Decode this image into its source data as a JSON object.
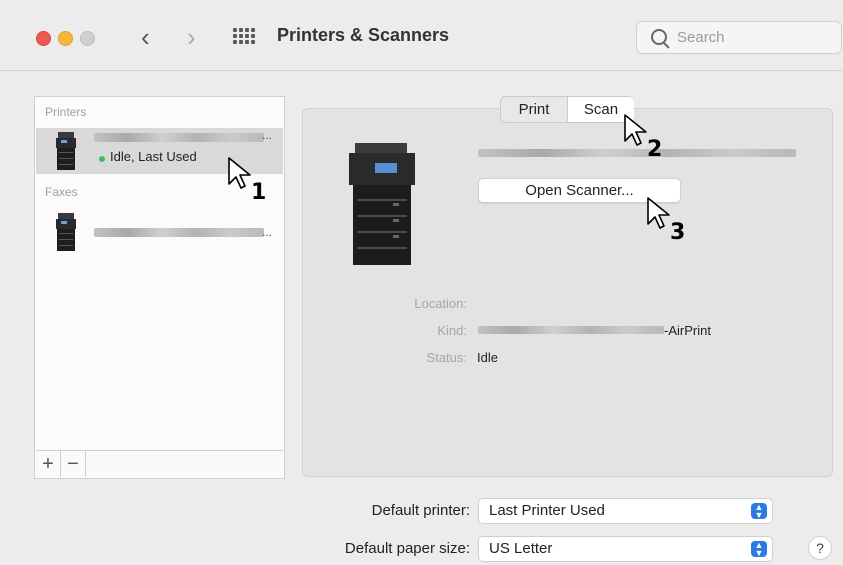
{
  "window": {
    "title": "Printers & Scanners",
    "search_placeholder": "Search"
  },
  "sidebar": {
    "printers_label": "Printers",
    "faxes_label": "Faxes",
    "printer_status": "Idle, Last Used",
    "ellipsis": "...",
    "add_label": "+",
    "remove_label": "−"
  },
  "tabs": {
    "print": "Print",
    "scan": "Scan",
    "selected": "Scan"
  },
  "detail": {
    "open_scanner_label": "Open Scanner...",
    "location_label": "Location:",
    "kind_label": "Kind:",
    "kind_suffix": "-AirPrint",
    "status_label": "Status:",
    "status_value": "Idle"
  },
  "footer": {
    "default_printer_label": "Default printer:",
    "default_printer_value": "Last Printer Used",
    "default_paper_label": "Default paper size:",
    "default_paper_value": "US Letter",
    "help_label": "?"
  },
  "callouts": [
    "1",
    "2",
    "3"
  ],
  "colors": {
    "accent": "#2b7ae4",
    "status_green": "#37c25a",
    "close": "#ee5a52",
    "minimize": "#f5b93a"
  }
}
